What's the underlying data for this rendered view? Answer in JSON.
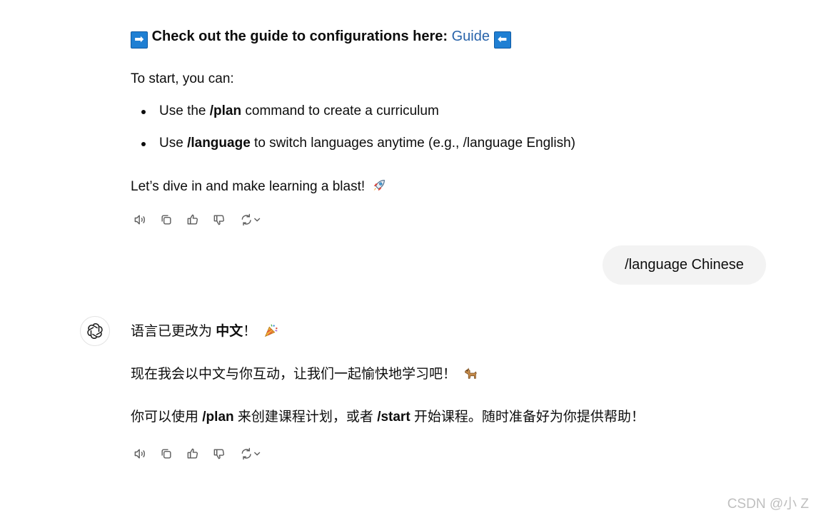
{
  "assistant_message_1": {
    "guide_line": {
      "arrow_left": "➡",
      "text": "Check out the guide to configurations here:",
      "link_label": "Guide",
      "arrow_right": "⬅"
    },
    "intro": "To start, you can:",
    "bullets": [
      {
        "pre": "Use the ",
        "bold": "/plan",
        "post": " command to create a curriculum"
      },
      {
        "pre": "Use ",
        "bold": "/language",
        "post": " to switch languages anytime (e.g., /language English)"
      }
    ],
    "closing": "Let’s dive in and make learning a blast!",
    "closing_emoji": "rocket-icon"
  },
  "user_message": {
    "text": "/language Chinese"
  },
  "assistant_message_2": {
    "line1_pre": "语言已更改为 ",
    "line1_bold": "中文",
    "line1_post": "！",
    "line1_emoji": "party-popper-icon",
    "line2": "现在我会以中文与你互动，让我们一起愉快地学习吧！",
    "line2_emoji": "dog-icon",
    "line3_pre": "你可以使用 ",
    "line3_bold1": "/plan",
    "line3_mid": " 来创建课程计划，或者 ",
    "line3_bold2": "/start",
    "line3_post": " 开始课程。随时准备好为你提供帮助！"
  },
  "actions": {
    "icons": [
      "speaker-icon",
      "copy-icon",
      "thumbs-up-icon",
      "thumbs-down-icon",
      "regenerate-icon"
    ]
  },
  "avatar_icon": "openai-logo-icon",
  "watermark": "CSDN @小 Z",
  "colors": {
    "link": "#2964aa",
    "bubble": "#f3f3f3",
    "arrow_box": "#1f7fd3",
    "text": "#0d0d0d"
  }
}
